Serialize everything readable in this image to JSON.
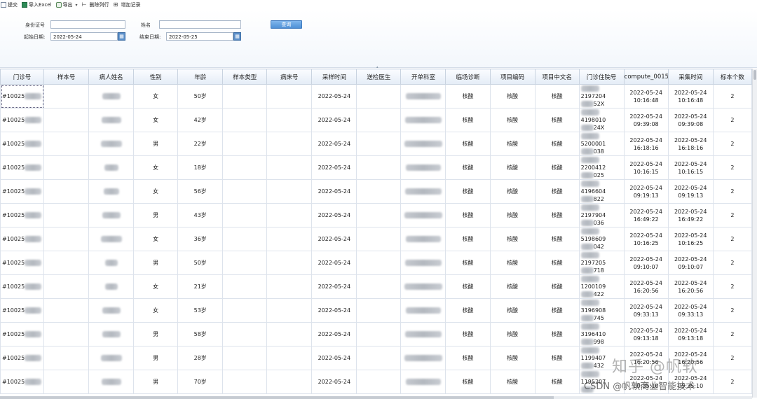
{
  "toolbar": {
    "submit": "提交",
    "import_excel": "导入Excel",
    "export": "导出",
    "delete_row": "删除列行",
    "add_record": "增加记录",
    "caret": "▾"
  },
  "form": {
    "id_label": "身份证号",
    "id_value": "",
    "name_label": "姓名",
    "name_value": "",
    "query_button": "查询",
    "start_label": "起始日期:",
    "start_value": "2022-05-24",
    "end_label": "结束日期:",
    "end_value": "2022-05-25",
    "cal_glyph": "▦"
  },
  "columns": [
    "门诊号",
    "样本号",
    "病人姓名",
    "性别",
    "年龄",
    "样本类型",
    "病床号",
    "采样时间",
    "送检医生",
    "开单科室",
    "临场诊断",
    "项目编码",
    "项目中文名",
    "门诊住院号",
    "compute_0015",
    "采集时间",
    "标本个数"
  ],
  "rows": [
    {
      "clinic": "#10025",
      "gender": "女",
      "age": "50岁",
      "sample_time": "2022-05-24",
      "diag": "核酸",
      "code": "核酸",
      "cn": "核酸",
      "inp_a": "2197204",
      "inp_b": "52X",
      "c_date": "2022-05-24",
      "c_time": "10:16:48",
      "t_date": "2022-05-24",
      "t_time": "10:16:48",
      "count": "2"
    },
    {
      "clinic": "#10025",
      "gender": "女",
      "age": "42岁",
      "sample_time": "2022-05-24",
      "diag": "核酸",
      "code": "核酸",
      "cn": "核酸",
      "inp_a": "4198010",
      "inp_b": "24X",
      "c_date": "2022-05-24",
      "c_time": "09:39:08",
      "t_date": "2022-05-24",
      "t_time": "09:39:08",
      "count": "2"
    },
    {
      "clinic": "#10025",
      "gender": "男",
      "age": "22岁",
      "sample_time": "2022-05-24",
      "diag": "核酸",
      "code": "核酸",
      "cn": "核酸",
      "inp_a": "5200001",
      "inp_b": "038",
      "c_date": "2022-05-24",
      "c_time": "16:18:16",
      "t_date": "2022-05-24",
      "t_time": "16:18:16",
      "count": "2"
    },
    {
      "clinic": "#10025",
      "gender": "女",
      "age": "18岁",
      "sample_time": "2022-05-24",
      "diag": "核酸",
      "code": "核酸",
      "cn": "核酸",
      "inp_a": "2200412",
      "inp_b": "025",
      "c_date": "2022-05-24",
      "c_time": "10:16:15",
      "t_date": "2022-05-24",
      "t_time": "10:16:15",
      "count": "2"
    },
    {
      "clinic": "#10025",
      "gender": "女",
      "age": "56岁",
      "sample_time": "2022-05-24",
      "diag": "核酸",
      "code": "核酸",
      "cn": "核酸",
      "inp_a": "4196604",
      "inp_b": "822",
      "c_date": "2022-05-24",
      "c_time": "09:19:13",
      "t_date": "2022-05-24",
      "t_time": "09:19:13",
      "count": "2"
    },
    {
      "clinic": "#10025",
      "gender": "男",
      "age": "43岁",
      "sample_time": "2022-05-24",
      "diag": "核酸",
      "code": "核酸",
      "cn": "核酸",
      "inp_a": "2197904",
      "inp_b": "036",
      "c_date": "2022-05-24",
      "c_time": "16:49:22",
      "t_date": "2022-05-24",
      "t_time": "16:49:22",
      "count": "2"
    },
    {
      "clinic": "#10025",
      "gender": "女",
      "age": "36岁",
      "sample_time": "2022-05-24",
      "diag": "核酸",
      "code": "核酸",
      "cn": "核酸",
      "inp_a": "5198609",
      "inp_b": "042",
      "c_date": "2022-05-24",
      "c_time": "10:16:25",
      "t_date": "2022-05-24",
      "t_time": "10:16:25",
      "count": "2"
    },
    {
      "clinic": "#10025",
      "gender": "男",
      "age": "50岁",
      "sample_time": "2022-05-24",
      "diag": "核酸",
      "code": "核酸",
      "cn": "核酸",
      "inp_a": "2197205",
      "inp_b": "718",
      "c_date": "2022-05-24",
      "c_time": "09:10:07",
      "t_date": "2022-05-24",
      "t_time": "09:10:07",
      "count": "2"
    },
    {
      "clinic": "#10025",
      "gender": "女",
      "age": "21岁",
      "sample_time": "2022-05-24",
      "diag": "核酸",
      "code": "核酸",
      "cn": "核酸",
      "inp_a": "1200109",
      "inp_b": "422",
      "c_date": "2022-05-24",
      "c_time": "16:20:56",
      "t_date": "2022-05-24",
      "t_time": "16:20:56",
      "count": "2"
    },
    {
      "clinic": "#10025",
      "gender": "女",
      "age": "53岁",
      "sample_time": "2022-05-24",
      "diag": "核酸",
      "code": "核酸",
      "cn": "核酸",
      "inp_a": "3196908",
      "inp_b": "745",
      "c_date": "2022-05-24",
      "c_time": "09:33:13",
      "t_date": "2022-05-24",
      "t_time": "09:33:13",
      "count": "2"
    },
    {
      "clinic": "#10025",
      "gender": "男",
      "age": "58岁",
      "sample_time": "2022-05-24",
      "diag": "核酸",
      "code": "核酸",
      "cn": "核酸",
      "inp_a": "3196410",
      "inp_b": "998",
      "c_date": "2022-05-24",
      "c_time": "09:13:18",
      "t_date": "2022-05-24",
      "t_time": "09:13:18",
      "count": "2"
    },
    {
      "clinic": "#10025",
      "gender": "男",
      "age": "28岁",
      "sample_time": "2022-05-24",
      "diag": "核酸",
      "code": "核酸",
      "cn": "核酸",
      "inp_a": "1199407",
      "inp_b": "432",
      "c_date": "2022-05-24",
      "c_time": "16:20:56",
      "t_date": "2022-05-24",
      "t_time": "16:20:56",
      "count": "2"
    },
    {
      "clinic": "#10025",
      "gender": "男",
      "age": "70岁",
      "sample_time": "2022-05-24",
      "diag": "核酸",
      "code": "核酸",
      "cn": "核酸",
      "inp_a": "1195207",
      "inp_b": "",
      "c_date": "2022-05-24",
      "c_time": "09:35:10",
      "t_date": "2022-05-24",
      "t_time": "09:35:10",
      "count": "2"
    }
  ],
  "watermark": {
    "zhihu": "知乎 @帆软",
    "csdn": "CSDN @帆软商业智能技术"
  }
}
